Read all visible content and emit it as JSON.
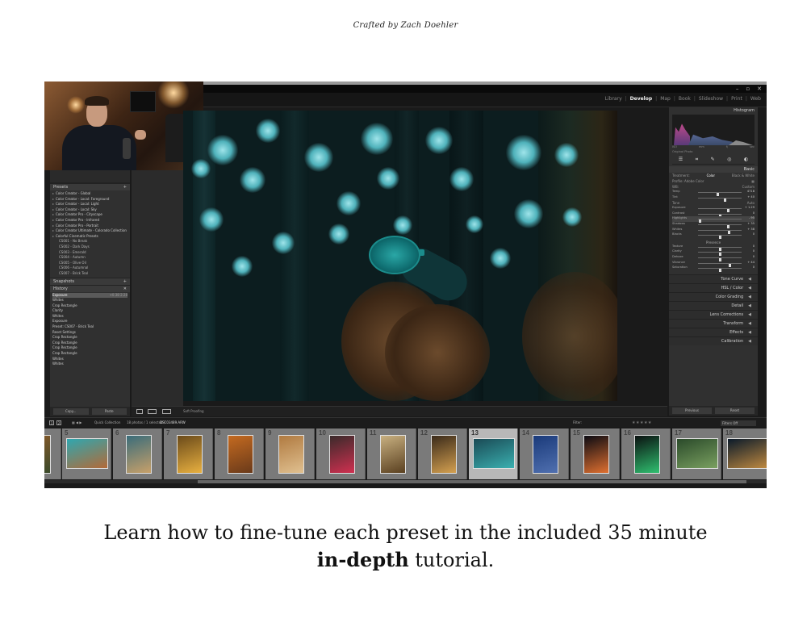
{
  "signature": "Crafted by Zach Doehler",
  "caption": {
    "line1": "Learn how to fine-tune each preset in the included 35 minute",
    "bold": "in-depth",
    "rest": " tutorial."
  },
  "window": {
    "controls": [
      "–",
      "▫",
      "✕"
    ]
  },
  "modules": [
    "Library",
    "Develop",
    "Map",
    "Book",
    "Slideshow",
    "Print",
    "Web"
  ],
  "active_module": "Develop",
  "left_panel": {
    "presets_title": "Presets",
    "presets": [
      "Color Creator - Global",
      "Color Creator - Local: Foreground",
      "Color Creator - Local: Light",
      "Color Creator - Local: Sky",
      "Color Creator Pro - Cityscape",
      "Color Creator Pro - Infrared",
      "Color Creator Pro - Portrait",
      "Color Creator Ultimate - Colorado Collection",
      "Colorful Cinematic Presets"
    ],
    "sub_presets": [
      "CS001 - No Break",
      "CS002 - Dark Days",
      "CS003 - Emerald",
      "CS004 - Autumn",
      "CS005 - Olive Oil",
      "CS006 - Autumnal",
      "CS007 - Brick Teal"
    ],
    "snapshots_title": "Snapshots",
    "history_title": "History",
    "history": [
      {
        "label": "Exposure",
        "val": "+0.38",
        "val2": "2.28",
        "sel": true
      },
      {
        "label": "Whites",
        "val": "",
        "val2": ""
      },
      {
        "label": "Crop Rectangle",
        "val": "",
        "val2": ""
      },
      {
        "label": "Clarity",
        "val": "",
        "val2": ""
      },
      {
        "label": "Whites",
        "val": "",
        "val2": ""
      },
      {
        "label": "Exposure",
        "val": "",
        "val2": ""
      },
      {
        "label": "Preset: CS007 - Brick Teal",
        "val": "",
        "val2": ""
      },
      {
        "label": "Reset Settings",
        "val": "",
        "val2": ""
      },
      {
        "label": "Crop Rectangle",
        "val": "",
        "val2": ""
      },
      {
        "label": "Crop Rectangle",
        "val": "",
        "val2": ""
      },
      {
        "label": "Crop Rectangle",
        "val": "",
        "val2": ""
      },
      {
        "label": "Crop Rectangle",
        "val": "",
        "val2": ""
      },
      {
        "label": "Whites",
        "val": "",
        "val2": ""
      },
      {
        "label": "Whites",
        "val": "",
        "val2": ""
      }
    ],
    "copy_label": "Copy...",
    "paste_label": "Paste"
  },
  "toolbar": {
    "soft_proofing": "Soft Proofing"
  },
  "right_panel": {
    "histogram_title": "Histogram",
    "histo_axis": [
      "ISO",
      "mm",
      "f/",
      "sec"
    ],
    "original_photo": "Original Photo",
    "basic_title": "Basic",
    "treatment": [
      "Treatment:",
      "Color",
      "Black & White"
    ],
    "profile": "Profile: Adobe Color",
    "wb_label": "WB:",
    "wb_value": "Custom",
    "tone_title": "Tone",
    "auto_label": "Auto",
    "presence_title": "Presence",
    "sliders_wb": [
      {
        "label": "Temp",
        "val": "4718",
        "pos": 0.45
      },
      {
        "label": "Tint",
        "val": "+ 40",
        "pos": 0.62
      }
    ],
    "sliders_tone": [
      {
        "label": "Exposure",
        "val": "+ 1.29",
        "pos": 0.68
      },
      {
        "label": "Contrast",
        "val": "0",
        "pos": 0.5
      },
      {
        "label": "Highlights",
        "val": "- 95",
        "pos": 0.03,
        "hl": true
      },
      {
        "label": "Shadows",
        "val": "+ 35",
        "pos": 0.68
      },
      {
        "label": "Whites",
        "val": "+ 38",
        "pos": 0.7
      },
      {
        "label": "Blacks",
        "val": "0",
        "pos": 0.5
      }
    ],
    "sliders_presence": [
      {
        "label": "Texture",
        "val": "0",
        "pos": 0.5
      },
      {
        "label": "Clarity",
        "val": "0",
        "pos": 0.5
      },
      {
        "label": "Dehaze",
        "val": "0",
        "pos": 0.5
      },
      {
        "label": "Vibrance",
        "val": "+ 44",
        "pos": 0.72
      },
      {
        "label": "Saturation",
        "val": "0",
        "pos": 0.5
      }
    ],
    "panels": [
      "Tone Curve",
      "HSL / Color",
      "Color Grading",
      "Detail",
      "Lens Corrections",
      "Transform",
      "Effects",
      "Calibration"
    ],
    "previous_label": "Previous",
    "reset_label": "Reset"
  },
  "filmbar": {
    "pages": [
      "1",
      "2"
    ],
    "quick_collection": "Quick Collection",
    "count": "18 photos / 1 selected /",
    "file": "DSC03489.ARW",
    "filter_label": "Filter:",
    "filter_value": "Filters Off",
    "stars": "★★★★★"
  },
  "filmstrip": {
    "cells": [
      {
        "num": "",
        "c1": "#8a5a2a",
        "c2": "#3a4a2a"
      },
      {
        "num": "5",
        "c1": "#2fa7b0",
        "c2": "#b36a38"
      },
      {
        "num": "6",
        "c1": "#3a6c7a",
        "c2": "#c7a06a"
      },
      {
        "num": "7",
        "c1": "#6a4a1a",
        "c2": "#e8b040"
      },
      {
        "num": "8",
        "c1": "#c46a20",
        "c2": "#6a3a1a"
      },
      {
        "num": "9",
        "c1": "#b07a40",
        "c2": "#e0c090"
      },
      {
        "num": "10",
        "c1": "#3a2a2a",
        "c2": "#d03050"
      },
      {
        "num": "11",
        "c1": "#c8b080",
        "c2": "#5a4020"
      },
      {
        "num": "12",
        "c1": "#3a2a1a",
        "c2": "#d4a050"
      },
      {
        "num": "13",
        "c1": "#1a4a55",
        "c2": "#3ab0b0",
        "sel": true
      },
      {
        "num": "14",
        "c1": "#1a3a7a",
        "c2": "#5070b0"
      },
      {
        "num": "15",
        "c1": "#0a0a12",
        "c2": "#e07030"
      },
      {
        "num": "16",
        "c1": "#0a1010",
        "c2": "#30c070"
      },
      {
        "num": "17",
        "c1": "#2a4a2a",
        "c2": "#7aa060"
      },
      {
        "num": "18",
        "c1": "#0a1a2a",
        "c2": "#c08a40"
      }
    ]
  }
}
